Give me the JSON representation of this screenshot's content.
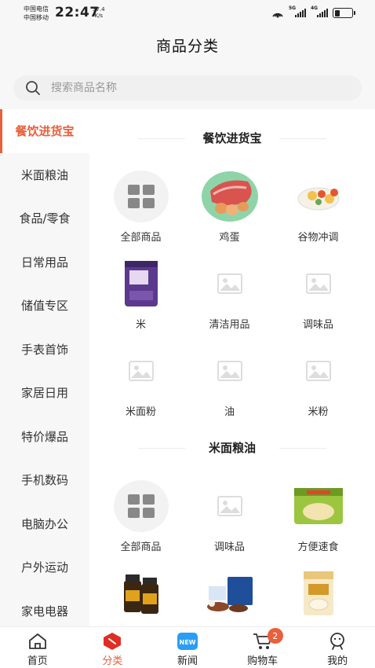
{
  "status_bar": {
    "carrier_1": "中国电信",
    "carrier_2": "中国移动",
    "time": "22:47",
    "net_speed_value": "37.4",
    "net_speed_unit": "K/s",
    "signal_1_tag": "5G",
    "signal_2_tag": "4G",
    "battery_level": 0.3
  },
  "header": {
    "title": "商品分类"
  },
  "search": {
    "placeholder": "搜索商品名称"
  },
  "sidebar": {
    "active_color": "#e8603c",
    "items": [
      {
        "label": "餐饮进货宝",
        "active": true
      },
      {
        "label": "米面粮油"
      },
      {
        "label": "食品/零食"
      },
      {
        "label": "日常用品"
      },
      {
        "label": "储值专区"
      },
      {
        "label": "手表首饰"
      },
      {
        "label": "家居日用"
      },
      {
        "label": "特价爆品"
      },
      {
        "label": "手机数码"
      },
      {
        "label": "电脑办公"
      },
      {
        "label": "户外运动"
      },
      {
        "label": "家电电器"
      }
    ]
  },
  "sections": [
    {
      "title": "餐饮进货宝",
      "items": [
        {
          "label": "全部商品",
          "icon": "all-grid-icon"
        },
        {
          "label": "鸡蛋",
          "icon": "meat-eggs-photo"
        },
        {
          "label": "谷物冲调",
          "icon": "cereal-bowl-photo"
        },
        {
          "label": "米",
          "icon": "rice-bag-photo"
        },
        {
          "label": "清洁用品",
          "icon": "image-placeholder-icon"
        },
        {
          "label": "调味品",
          "icon": "image-placeholder-icon"
        },
        {
          "label": "米面粉",
          "icon": "image-placeholder-icon"
        },
        {
          "label": "油",
          "icon": "image-placeholder-icon"
        },
        {
          "label": "米粉",
          "icon": "image-placeholder-icon"
        }
      ]
    },
    {
      "title": "米面粮油",
      "items": [
        {
          "label": "全部商品",
          "icon": "all-grid-icon"
        },
        {
          "label": "调味品",
          "icon": "image-placeholder-icon"
        },
        {
          "label": "方便速食",
          "icon": "instant-noodle-photo"
        },
        {
          "label": "",
          "icon": "sauce-jars-photo"
        },
        {
          "label": "",
          "icon": "gift-box-photo"
        },
        {
          "label": "",
          "icon": "flour-bag-photo"
        }
      ]
    }
  ],
  "bottom_nav": {
    "items": [
      {
        "label": "首页",
        "icon": "home-icon"
      },
      {
        "label": "分类",
        "icon": "category-icon",
        "active": true
      },
      {
        "label": "新闻",
        "icon": "news-icon",
        "icon_text": "NEW"
      },
      {
        "label": "购物车",
        "icon": "cart-icon",
        "badge": "2"
      },
      {
        "label": "我的",
        "icon": "profile-icon"
      }
    ]
  }
}
